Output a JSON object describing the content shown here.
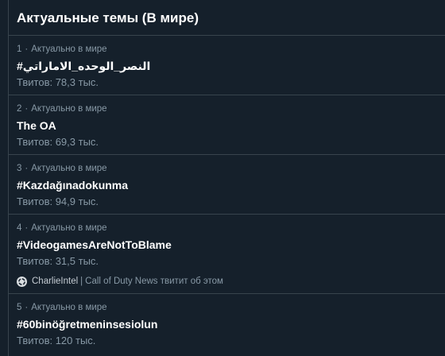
{
  "panel": {
    "title": "Актуальные темы (В мире)"
  },
  "trends": [
    {
      "rank": "1",
      "context": "Актуально в мире",
      "name": "#النصر_الوحده_الاماراتي",
      "tweets": "Твитов: 78,3 тыс."
    },
    {
      "rank": "2",
      "context": "Актуально в мире",
      "name": "The OA",
      "tweets": "Твитов: 69,3 тыс."
    },
    {
      "rank": "3",
      "context": "Актуально в мире",
      "name": "#Kazdağınadokunma",
      "tweets": "Твитов: 94,9 тыс."
    },
    {
      "rank": "4",
      "context": "Актуально в мире",
      "name": "#VideogamesAreNotToBlame",
      "tweets": "Твитов: 31,5 тыс.",
      "related": {
        "user": "CharlieIntel",
        "separator": "|",
        "text": "Call of Duty News твитит об этом",
        "avatar_icon": "circular-arrows-icon"
      }
    },
    {
      "rank": "5",
      "context": "Актуально в мире",
      "name": "#60binöğretmeninsesiolun",
      "tweets": "Твитов: 120 тыс."
    }
  ],
  "meta_separator": "·",
  "colors": {
    "background": "#15202b",
    "divider": "#38444d",
    "text_primary": "#ffffff",
    "text_secondary": "#8899a6"
  }
}
